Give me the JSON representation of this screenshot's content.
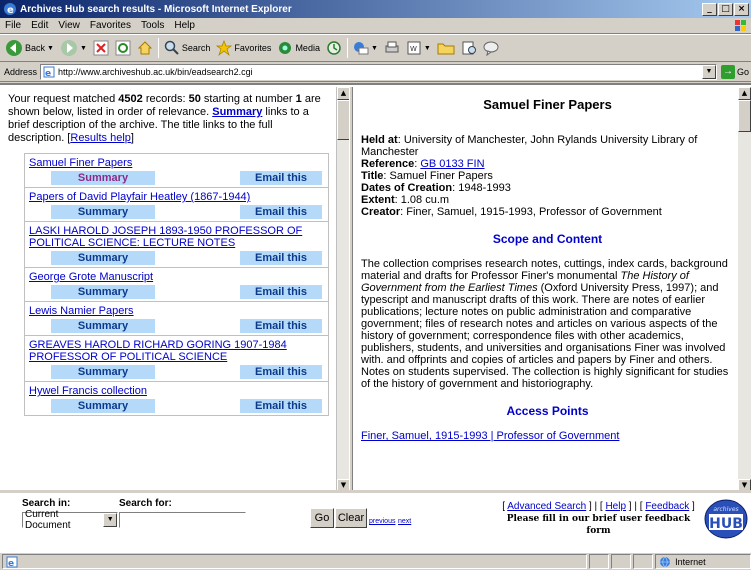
{
  "window": {
    "title": "Archives Hub search results - Microsoft Internet Explorer",
    "minimize": "_",
    "maximize": "□",
    "close": "×"
  },
  "menu": [
    "File",
    "Edit",
    "View",
    "Favorites",
    "Tools",
    "Help"
  ],
  "toolbar": {
    "back": "Back",
    "search": "Search",
    "favorites": "Favorites",
    "media": "Media"
  },
  "address": {
    "label": "Address",
    "url": "http://www.archiveshub.ac.uk/bin/eadsearch2.cgi",
    "go": "Go"
  },
  "left": {
    "intro_prefix": "Your request matched ",
    "record_count": "4502",
    "intro_mid1": " records: ",
    "shown_count": "50",
    "intro_mid2": " starting at number ",
    "start_number": "1",
    "intro_mid3": " are shown below, listed in order of relevance.",
    "summary_link": "Summary",
    "intro_mid4": " links to a brief description of the archive. The title links to the full description.  [",
    "results_help": "Results help",
    "intro_end": "]",
    "summary_label": "Summary",
    "email_label": "Email this",
    "results": [
      {
        "title": "Samuel Finer Papers"
      },
      {
        "title": "Papers of David Playfair Heatley (1867-1944)"
      },
      {
        "title": "LASKI HAROLD JOSEPH 1893-1950 PROFESSOR OF POLITICAL SCIENCE: LECTURE NOTES"
      },
      {
        "title": "George Grote Manuscript"
      },
      {
        "title": "Lewis Namier Papers"
      },
      {
        "title": "GREAVES HAROLD RICHARD GORING 1907-1984 PROFESSOR OF POLITICAL SCIENCE"
      },
      {
        "title": "Hywel Francis collection"
      }
    ]
  },
  "right": {
    "title": "Samuel Finer Papers",
    "held_at_label": "Held at",
    "held_at": "University of Manchester, John Rylands University Library of Manchester",
    "reference_label": "Reference",
    "reference": "GB 0133 FIN",
    "title_label": "Title",
    "title_value": "Samuel Finer Papers",
    "dates_label": "Dates of Creation",
    "dates": "1948-1993",
    "extent_label": "Extent",
    "extent": "1.08 cu.m",
    "creator_label": "Creator",
    "creator": "Finer, Samuel, 1915-1993, Professor of Government",
    "scope_heading": "Scope and Content",
    "scope_1": "The collection comprises research notes, cuttings, index cards, background material and drafts for Professor Finer's monumental ",
    "scope_italic": "The History of Government from the Earliest Times",
    "scope_2": " (Oxford University Press, 1997); and typescript and manuscript drafts of this work. There are notes of earlier publications; lecture notes on public administration and comparative government; files of research notes and articles on various aspects of the history of government; correspondence files with other academics, publishers, students, and universities and organisations Finer was involved with. and offprints and copies of articles and papers by Finer and others. Notes on students supervised. The collection is highly significant for studies of the history of government and historiography.",
    "access_heading": "Access Points",
    "access_point": "Finer, Samuel, 1915-1993 | Professor of Government"
  },
  "bottom": {
    "search_in_label": "Search in:",
    "search_for_label": "Search for:",
    "search_in_value": "Current Document",
    "search_for_value": "",
    "go": "Go",
    "clear": "Clear",
    "previous": "previous",
    "next": "next",
    "advanced": "Advanced Search",
    "help": "Help",
    "feedback": "Feedback",
    "feedback_note": "Please fill in our brief user feedback form",
    "logo_small": "archives",
    "logo_big": "HUB"
  },
  "status": {
    "zone": "Internet"
  }
}
